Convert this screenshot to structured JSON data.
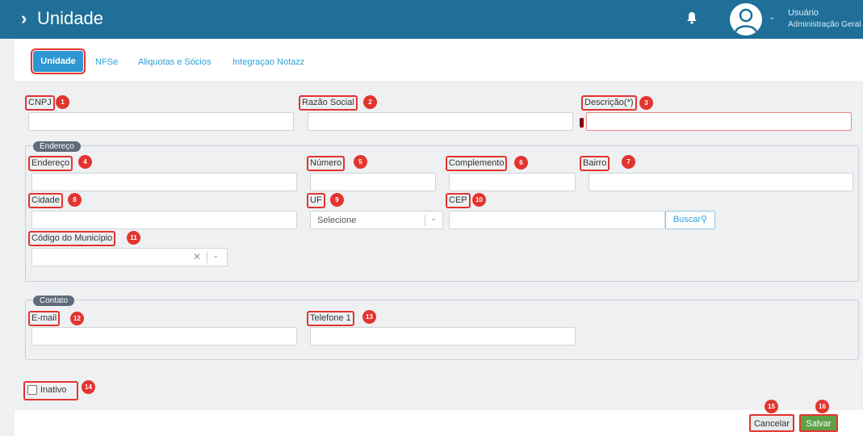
{
  "header": {
    "title": "Unidade",
    "user_name": "Usuário",
    "user_role": "Administração Geral"
  },
  "tabs": [
    "Unidade",
    "NFSe",
    "Aliquotas e Sócios",
    "Integraçao Notazz"
  ],
  "fields": {
    "cnpj": "CNPJ",
    "razao_social": "Razão Social",
    "descricao": "Descrição(*)",
    "endereco": "Endereço",
    "numero": "Número",
    "complemento": "Complemento",
    "bairro": "Bairro",
    "cidade": "Cidade",
    "uf": "UF",
    "cep": "CEP",
    "codigo_municipio": "Código do Município",
    "email": "E-mail",
    "telefone": "Telefone 1",
    "inativo": "Inativo"
  },
  "sections": {
    "endereco": "Endereço",
    "contato": "Contato"
  },
  "uf_select": {
    "value": "Selecione"
  },
  "buttons": {
    "buscar": "Buscar",
    "cancelar": "Cancelar",
    "salvar": "Salvar"
  },
  "badges": [
    "1",
    "2",
    "3",
    "4",
    "5",
    "6",
    "7",
    "8",
    "9",
    "10",
    "11",
    "12",
    "13",
    "14",
    "15",
    "16"
  ],
  "colors": {
    "header": "#1f6f98",
    "accent": "#2d97d3",
    "highlight": "#e3342f",
    "save": "#5da246"
  }
}
